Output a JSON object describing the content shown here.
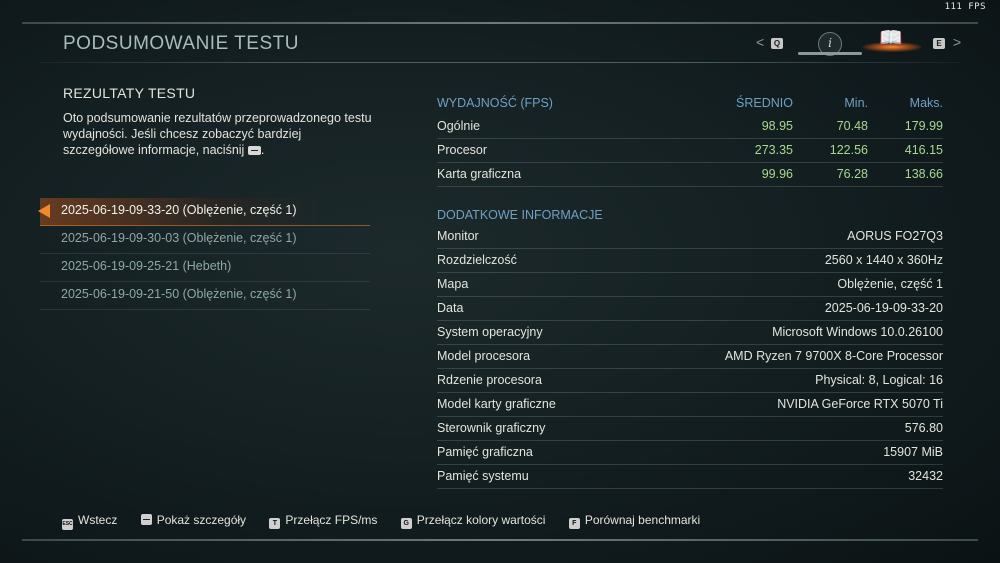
{
  "fps_counter": "111 FPS",
  "page_title": "PODSUMOWANIE TESTU",
  "nav": {
    "prev_key": "Q",
    "next_key": "E",
    "info_glyph": "i",
    "book_glyph": "📖",
    "tabs": [
      "info-icon",
      "book-icon"
    ]
  },
  "left": {
    "heading": "REZULTATY TESTU",
    "description_before": "Oto podsumowanie rezultatów przeprowadzonego testu wydajności. Jeśli chcesz zobaczyć bardziej szczegółowe informacje, naciśnij",
    "description_after": "."
  },
  "results": [
    {
      "label": "2025-06-19-09-33-20 (Oblężenie, część 1)",
      "selected": true
    },
    {
      "label": "2025-06-19-09-30-03 (Oblężenie, część 1)",
      "selected": false
    },
    {
      "label": "2025-06-19-09-25-21 (Hebeth)",
      "selected": false
    },
    {
      "label": "2025-06-19-09-21-50 (Oblężenie, część 1)",
      "selected": false
    }
  ],
  "performance": {
    "header": {
      "title": "WYDAJNOŚĆ (FPS)",
      "avg": "ŚREDNIO",
      "min": "Min.",
      "max": "Maks."
    },
    "rows": [
      {
        "label": "Ogólnie",
        "avg": "98.95",
        "min": "70.48",
        "max": "179.99"
      },
      {
        "label": "Procesor",
        "avg": "273.35",
        "min": "122.56",
        "max": "416.15"
      },
      {
        "label": "Karta graficzna",
        "avg": "99.96",
        "min": "76.28",
        "max": "138.66"
      }
    ]
  },
  "additional": {
    "title": "DODATKOWE INFORMACJE",
    "rows": [
      {
        "label": "Monitor",
        "value": "AORUS FO27Q3"
      },
      {
        "label": "Rozdzielczość",
        "value": "2560 x 1440 x 360Hz"
      },
      {
        "label": "Mapa",
        "value": "Oblężenie, część 1"
      },
      {
        "label": "Data",
        "value": "2025-06-19-09-33-20"
      },
      {
        "label": "System operacyjny",
        "value": "Microsoft Windows 10.0.26100"
      },
      {
        "label": "Model procesora",
        "value": "AMD Ryzen 7 9700X 8-Core Processor"
      },
      {
        "label": "Rdzenie procesora",
        "value": "Physical: 8, Logical: 16"
      },
      {
        "label": "Model karty graficzne",
        "value": "NVIDIA GeForce RTX 5070 Ti"
      },
      {
        "label": "Sterownik graficzny",
        "value": "576.80"
      },
      {
        "label": "Pamięć graficzna",
        "value": "15907 MiB"
      },
      {
        "label": "Pamięć systemu",
        "value": "32432"
      }
    ]
  },
  "footer": [
    {
      "key": "ESC",
      "label": "Wstecz"
    },
    {
      "key": "",
      "label": "Pokaż szczegóły"
    },
    {
      "key": "T",
      "label": "Przełącz FPS/ms"
    },
    {
      "key": "G",
      "label": "Przełącz kolory wartości"
    },
    {
      "key": "F",
      "label": "Porównaj benchmarki"
    }
  ],
  "colors": {
    "accent_orange": "#f08a2a",
    "value_green": "#a8d890",
    "section_blue": "#6fa0c4",
    "title_teal": "#a8bcbc"
  }
}
